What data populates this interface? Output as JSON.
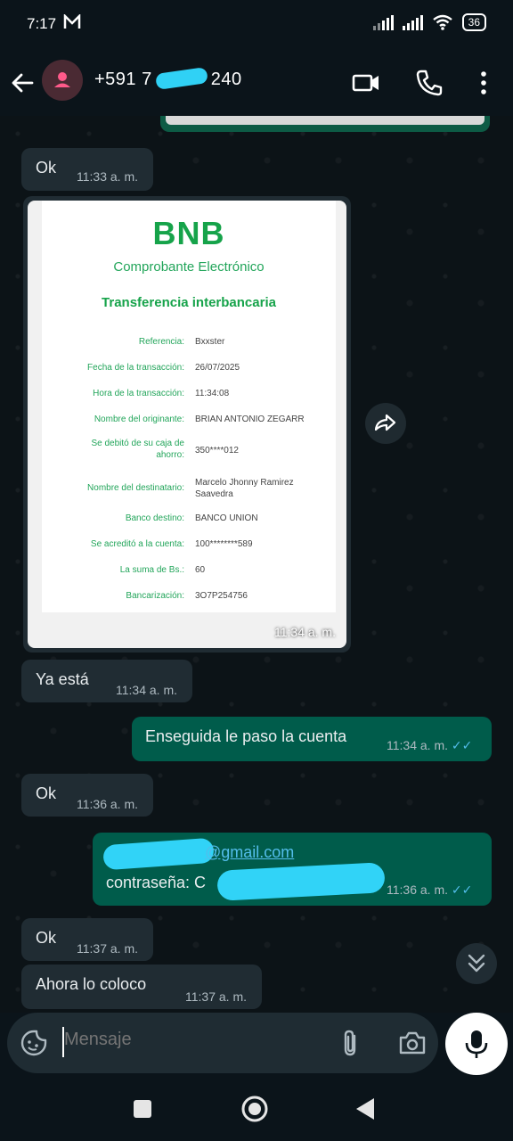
{
  "status_bar": {
    "time": "7:17",
    "battery": "36"
  },
  "header": {
    "contact_prefix": "+591 7",
    "contact_suffix": "240"
  },
  "messages": {
    "m1": {
      "text": "Ok",
      "time": "11:33 a. m."
    },
    "receipt": {
      "logo": "BNB",
      "subtitle": "Comprobante Electrónico",
      "title": "Transferencia interbancaria",
      "rows": [
        {
          "label": "Referencia:",
          "value": "Bxxster"
        },
        {
          "label": "Fecha de la transacción:",
          "value": "26/07/2025"
        },
        {
          "label": "Hora de la transacción:",
          "value": "11:34:08"
        },
        {
          "label": "Nombre del originante:",
          "value": "BRIAN ANTONIO ZEGARR"
        },
        {
          "label": "Se debitó de su caja de ahorro:",
          "value": "350****012"
        },
        {
          "label": "Nombre del destinatario:",
          "value": "Marcelo Jhonny Ramirez Saavedra"
        },
        {
          "label": "Banco destino:",
          "value": "BANCO UNION"
        },
        {
          "label": "Se acreditó a la cuenta:",
          "value": "100********589"
        },
        {
          "label": "La suma de Bs.:",
          "value": "60"
        },
        {
          "label": "Bancarización:",
          "value": "3O7P254756"
        }
      ],
      "time": "11:34 a. m."
    },
    "m2": {
      "text": "Ya está",
      "time": "11:34 a. m."
    },
    "m3": {
      "text": "Enseguida le paso la cuenta",
      "time": "11:34 a. m."
    },
    "m4": {
      "text": "Ok",
      "time": "11:36 a. m."
    },
    "m5": {
      "email_visible": "@gmail.com",
      "password_label": "contraseña: C",
      "time": "11:36 a. m."
    },
    "m6": {
      "text": "Ok",
      "time": "11:37 a. m."
    },
    "m7": {
      "text": "Ahora lo coloco",
      "time": "11:37 a. m."
    }
  },
  "composer": {
    "placeholder": "Mensaje"
  },
  "colors": {
    "incoming": "#202c33",
    "outgoing": "#005c4b",
    "read_ticks": "#53bdeb",
    "bnb_green": "#16a34a"
  }
}
